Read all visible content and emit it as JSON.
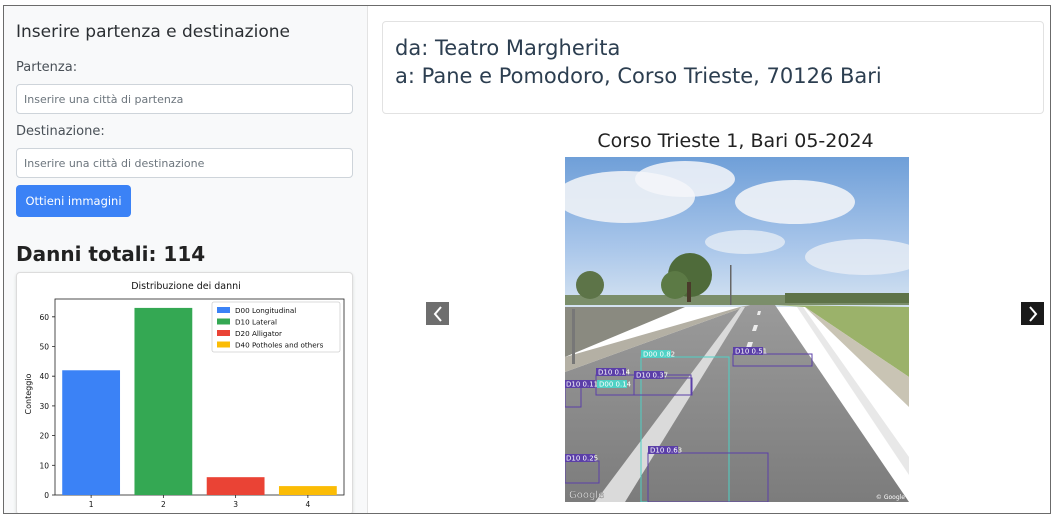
{
  "sidebar": {
    "title": "Inserire partenza e destinazione",
    "start_label": "Partenza:",
    "start_placeholder": "Inserire una città di partenza",
    "dest_label": "Destinazione:",
    "dest_placeholder": "Inserire una città di destinazione",
    "button_label": "Ottieni immagini",
    "total_damage": "Danni totali: 114"
  },
  "route": {
    "from": "da: Teatro Margherita",
    "to": "a: Pane e Pomodoro, Corso Trieste, 70126 Bari"
  },
  "image": {
    "caption": "Corso Trieste 1, Bari 05-2024",
    "watermark_left": "Google",
    "watermark_right": "© Google",
    "detections": [
      {
        "label": "D00 0.82",
        "color": "#4fd1c5"
      },
      {
        "label": "D10 0.51",
        "color": "#5b3fa8"
      },
      {
        "label": "D10 0.14",
        "color": "#5b3fa8"
      },
      {
        "label": "D10 0.37",
        "color": "#5b3fa8"
      },
      {
        "label": "D10 0.11",
        "color": "#5b3fa8"
      },
      {
        "label": "D00 0.14",
        "color": "#4fd1c5"
      },
      {
        "label": "D10 0.25",
        "color": "#5b3fa8"
      },
      {
        "label": "D10 0.63",
        "color": "#5b3fa8"
      }
    ]
  },
  "colors": {
    "primary": "#3b82f6",
    "d00": "#3b82f6",
    "d10": "#34a853",
    "d20": "#ea4335",
    "d40": "#fbbc05"
  },
  "chart_data": {
    "type": "bar",
    "title": "Distribuzione dei danni",
    "xlabel": "",
    "ylabel": "Conteggio",
    "categories": [
      "1",
      "2",
      "3",
      "4"
    ],
    "values": [
      42,
      63,
      6,
      3
    ],
    "bar_colors": [
      "#3b82f6",
      "#34a853",
      "#ea4335",
      "#fbbc05"
    ],
    "ylim": [
      0,
      66
    ],
    "yticks": [
      0,
      10,
      20,
      30,
      40,
      50,
      60
    ],
    "legend": [
      "D00 Longitudinal",
      "D10 Lateral",
      "D20 Alligator",
      "D40 Potholes and others"
    ],
    "legend_position": "top-right",
    "grid": false
  }
}
